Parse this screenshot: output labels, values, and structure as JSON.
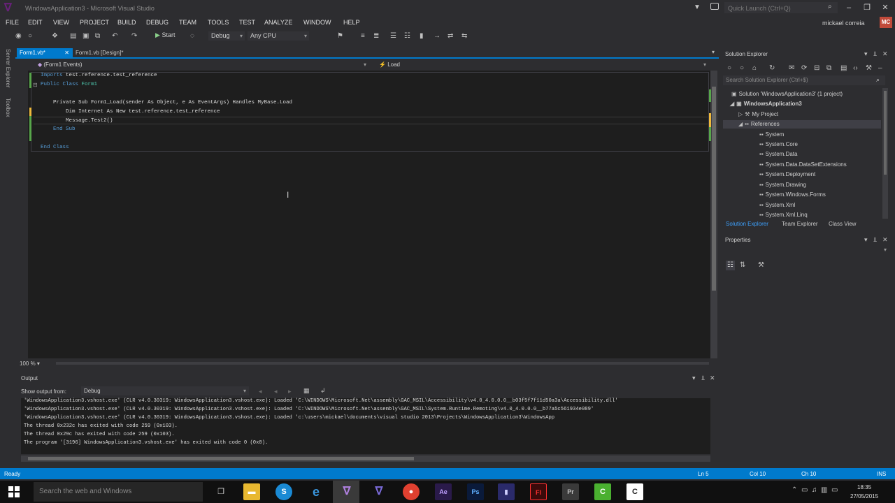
{
  "window": {
    "title": "WindowsApplication3 - Microsoft Visual Studio",
    "quick_launch_placeholder": "Quick Launch (Ctrl+Q)",
    "user_name": "mickael correia",
    "user_initials": "MC"
  },
  "menu": [
    "FILE",
    "EDIT",
    "VIEW",
    "PROJECT",
    "BUILD",
    "DEBUG",
    "TEAM",
    "TOOLS",
    "TEST",
    "ANALYZE",
    "WINDOW",
    "HELP"
  ],
  "toolbar": {
    "start_label": "Start",
    "config": "Debug",
    "platform": "Any CPU"
  },
  "left_tabs": [
    "Server Explorer",
    "Toolbox"
  ],
  "doc_tabs": [
    {
      "label": "Form1.vb*",
      "active": true
    },
    {
      "label": "Form1.vb [Design]*",
      "active": false
    }
  ],
  "nav": {
    "left": "(Form1 Events)",
    "right": "Load"
  },
  "code_lines": [
    "Imports test.reference.test_reference",
    "Public Class Form1",
    "",
    "    Private Sub Form1_Load(sender As Object, e As EventArgs) Handles MyBase.Load",
    "        Dim Internet As New test.reference.test_reference",
    "        Message.Test2()",
    "    End Sub",
    "",
    "End Class"
  ],
  "zoom": "100 %",
  "output": {
    "title": "Output",
    "show_from_label": "Show output from:",
    "source": "Debug",
    "lines": [
      "'WindowsApplication3.vshost.exe' (CLR v4.0.30319: WindowsApplication3.vshost.exe): Loaded 'C:\\WINDOWS\\Microsoft.Net\\assembly\\GAC_MSIL\\Accessibility\\v4.0_4.0.0.0__b03f5f7f11d50a3a\\Accessibility.dll'",
      "'WindowsApplication3.vshost.exe' (CLR v4.0.30319: WindowsApplication3.vshost.exe): Loaded 'C:\\WINDOWS\\Microsoft.Net\\assembly\\GAC_MSIL\\System.Runtime.Remoting\\v4.0_4.0.0.0__b77a5c561934e089'",
      "'WindowsApplication3.vshost.exe' (CLR v4.0.30319: WindowsApplication3.vshost.exe): Loaded 'c:\\users\\mickael\\documents\\visual studio 2013\\Projects\\WindowsApplication3\\WindowsApp",
      "The thread 0x232c has exited with code 259 (0x103).",
      "The thread 0x29c has exited with code 259 (0x103).",
      "The program '[3196] WindowsApplication3.vshost.exe' has exited with code 0 (0x0)."
    ]
  },
  "solution_explorer": {
    "title": "Solution Explorer",
    "search_placeholder": "Search Solution Explorer (Ctrl+$)",
    "tree": [
      {
        "label": "Solution 'WindowsApplication3' (1 project)",
        "indent": 0,
        "bold": false
      },
      {
        "label": "WindowsApplication3",
        "indent": 1,
        "bold": true
      },
      {
        "label": "My Project",
        "indent": 2,
        "bold": false
      },
      {
        "label": "References",
        "indent": 2,
        "bold": false
      },
      {
        "label": "System",
        "indent": 3,
        "bold": false
      },
      {
        "label": "System.Core",
        "indent": 3,
        "bold": false
      },
      {
        "label": "System.Data",
        "indent": 3,
        "bold": false
      },
      {
        "label": "System.Data.DataSetExtensions",
        "indent": 3,
        "bold": false
      },
      {
        "label": "System.Deployment",
        "indent": 3,
        "bold": false
      },
      {
        "label": "System.Drawing",
        "indent": 3,
        "bold": false
      },
      {
        "label": "System.Windows.Forms",
        "indent": 3,
        "bold": false
      },
      {
        "label": "System.Xml",
        "indent": 3,
        "bold": false
      },
      {
        "label": "System.Xml.Linq",
        "indent": 3,
        "bold": false
      }
    ],
    "bottom_tabs": [
      "Solution Explorer",
      "Team Explorer",
      "Class View"
    ]
  },
  "properties": {
    "title": "Properties"
  },
  "status": {
    "ready": "Ready",
    "line": "Ln 5",
    "col": "Col 10",
    "ch": "Ch 10",
    "mode": "INS"
  },
  "taskbar": {
    "search_placeholder": "Search the web and Windows",
    "time": "18:35",
    "date": "27/05/2015"
  },
  "colors": {
    "accent": "#007acc",
    "editor_bg": "#1e1e1e",
    "chrome_bg": "#2d2d30",
    "keyword": "#569cd6",
    "type": "#4ec9b0",
    "change_saved": "#57a64a",
    "change_unsaved": "#efb93c"
  }
}
